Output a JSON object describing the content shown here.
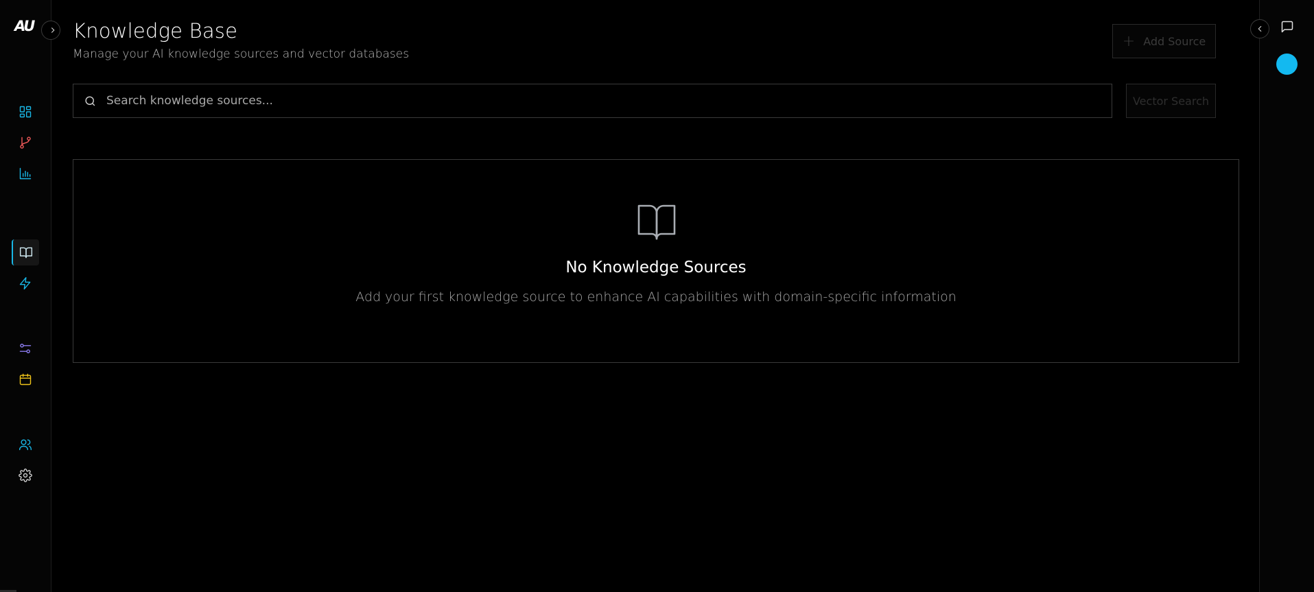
{
  "app": {
    "logo_text": "AU"
  },
  "header": {
    "title": "Knowledge Base",
    "subtitle": "Manage your AI knowledge sources and vector databases",
    "add_source_label": "Add Source"
  },
  "search": {
    "placeholder": "Search knowledge sources...",
    "value": "",
    "vector_search_label": "Vector Search"
  },
  "empty_state": {
    "icon": "book-open-icon",
    "title": "No Knowledge Sources",
    "description": "Add your first knowledge source to enhance AI capabilities with domain-specific information"
  },
  "sidebar": {
    "items": [
      {
        "id": "dashboard",
        "icon": "dashboard-grid-icon",
        "color": "#19b7e6"
      },
      {
        "id": "workflows",
        "icon": "git-branch-icon",
        "color": "#f05a5a"
      },
      {
        "id": "analytics",
        "icon": "bar-chart-icon",
        "color": "#19b7e6"
      },
      {
        "id": "knowledge-base",
        "icon": "book-open-icon",
        "color": "#19b7e6",
        "active": true
      },
      {
        "id": "automations",
        "icon": "lightning-icon",
        "color": "#19b7e6"
      },
      {
        "id": "integrations",
        "icon": "sliders-icon",
        "color": "#8c7cf0"
      },
      {
        "id": "calendar",
        "icon": "calendar-icon",
        "color": "#f0c419"
      },
      {
        "id": "team",
        "icon": "users-icon",
        "color": "#19b7e6"
      },
      {
        "id": "settings",
        "icon": "gear-icon",
        "color": "#cfcfcf"
      }
    ]
  },
  "colors": {
    "accent": "#19b7e6",
    "status_dot": "#13b9f0",
    "background": "#000000"
  }
}
